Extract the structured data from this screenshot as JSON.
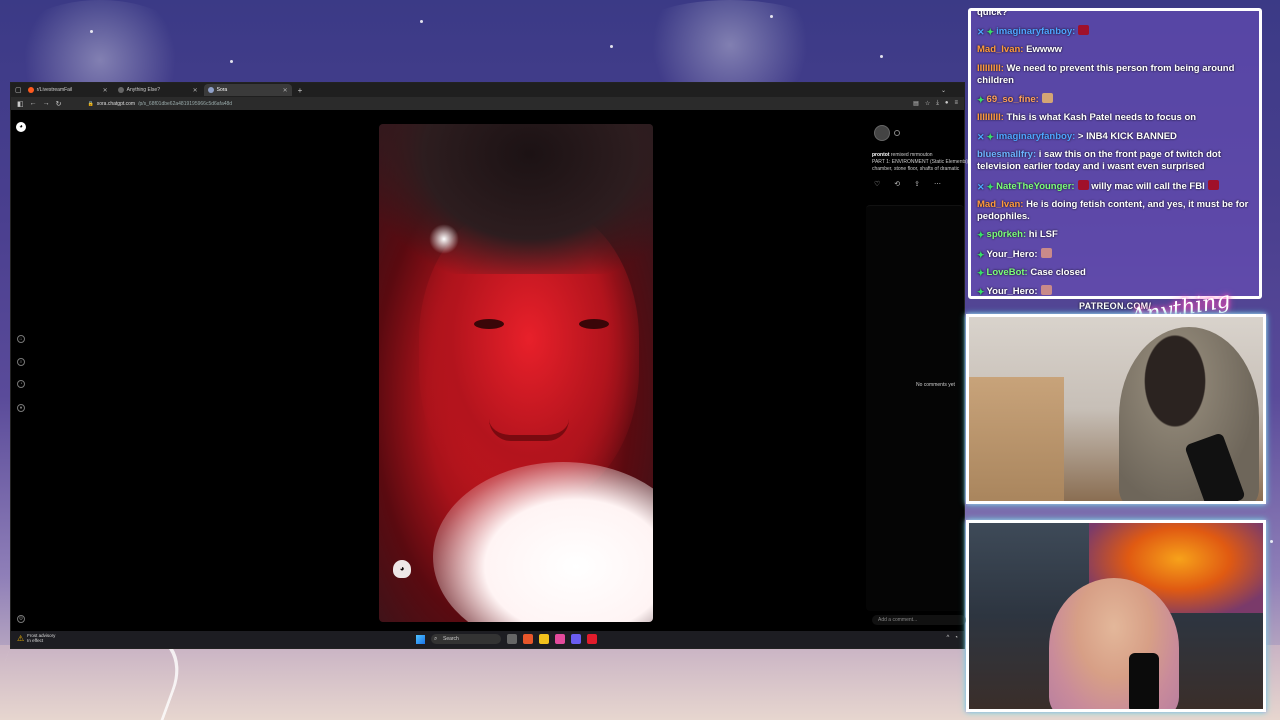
{
  "browser": {
    "tabs": [
      {
        "label": "r/LivestreamFail"
      },
      {
        "label": "Anything Else?"
      },
      {
        "label": "Sora"
      }
    ],
    "url_host": "sora.chatgpt.com",
    "url_path": "/p/s_68f01dbe62a4819195966c5d6afa48d"
  },
  "post": {
    "author": "prontot",
    "action": "remixed mrmouton",
    "description_line1": "PART 1: ENVIRONMENT (Static Elements)",
    "description_line2": "chamber, stone floor, shafts of dramatic",
    "no_comments": "No comments yet",
    "comment_placeholder": "Add a comment..."
  },
  "taskbar": {
    "weather_line1": "Frost advisory",
    "weather_line2": "In effect",
    "search_label": "Search"
  },
  "chat": {
    "messages": [
      {
        "user": "",
        "text": "quick?",
        "user_color": "#ffffff"
      },
      {
        "user": "imaginaryfanboy:",
        "text": "",
        "user_color": "#4ea5ff",
        "badges": [
          "x",
          "g"
        ],
        "emote": "#a0102a"
      },
      {
        "user": "Mad_Ivan:",
        "text": "Ewwww",
        "user_color": "#ff9a3c"
      },
      {
        "user": "IIIIIIIII:",
        "text": "We need to prevent this person from being around children",
        "user_color": "#ff9a3c"
      },
      {
        "user": "69_so_fine:",
        "text": "",
        "user_color": "#ffa05a",
        "badges": [
          "g"
        ],
        "emote": "#d4a574"
      },
      {
        "user": "IIIIIIIII:",
        "text": "This is what Kash Patel needs to focus on",
        "user_color": "#ff9a3c"
      },
      {
        "user": "imaginaryfanboy:",
        "text": "> INB4 KICK BANNED",
        "user_color": "#4ea5ff",
        "badges": [
          "x",
          "g"
        ]
      },
      {
        "user": "bluesmallfry:",
        "text": "i saw this on the front page of twitch dot television earlier today and i wasnt even surprised",
        "user_color": "#6cb4ff"
      },
      {
        "user": "NateTheYounger:",
        "text": "willy mac will call the FBI",
        "user_color": "#7cff7a",
        "badges": [
          "x",
          "g"
        ],
        "emote": "#a0102a",
        "emote_end": "#a0102a"
      },
      {
        "user": "Mad_Ivan:",
        "text": "He is doing fetish content, and yes, it must be for pedophiles.",
        "user_color": "#ff9a3c"
      },
      {
        "user": "sp0rkeh:",
        "text": "hi LSF",
        "user_color": "#7cff7a",
        "badges": [
          "g"
        ]
      },
      {
        "user": "Your_Hero:",
        "text": "",
        "user_color": "#ffffff",
        "badges": [
          "g"
        ],
        "emote": "#c98a8a"
      },
      {
        "user": "LoveBot:",
        "text": "Case closed",
        "user_color": "#7cff7a",
        "badges": [
          "g"
        ]
      },
      {
        "user": "Your_Hero:",
        "text": "",
        "user_color": "#ffffff",
        "badges": [
          "g"
        ],
        "emote": "#c98a8a"
      }
    ]
  },
  "overlay": {
    "patreon_label": "PATREON.COM/",
    "logo_text": "Anything Else?"
  },
  "colors": {
    "chat_border": "#ffffff",
    "cam_glow": "#4ff2e6"
  }
}
